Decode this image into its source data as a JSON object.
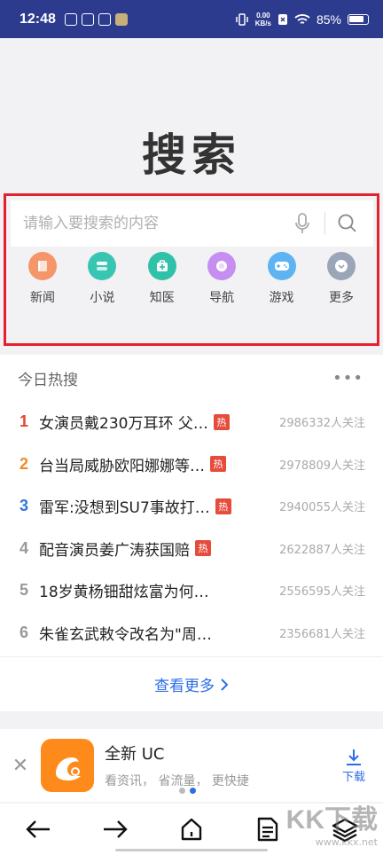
{
  "status_bar": {
    "time": "12:48",
    "net_speed_value": "0.00",
    "net_speed_unit": "KB/s",
    "battery": "85%"
  },
  "page_title": "搜索",
  "search": {
    "placeholder": "请输入要搜索的内容"
  },
  "quick_links": [
    {
      "label": "新闻",
      "color": "#f5956a",
      "icon": "news-icon"
    },
    {
      "label": "小说",
      "color": "#38c6b3",
      "icon": "novel-icon"
    },
    {
      "label": "知医",
      "color": "#2fc2a8",
      "icon": "medical-kit-icon"
    },
    {
      "label": "导航",
      "color": "#c58ef0",
      "icon": "navigation-icon"
    },
    {
      "label": "游戏",
      "color": "#5eb3f2",
      "icon": "gamepad-icon"
    },
    {
      "label": "更多",
      "color": "#9aa5b8",
      "icon": "more-chevron-icon"
    }
  ],
  "hot": {
    "title": "今日热搜",
    "items": [
      {
        "rank": "1",
        "rank_color": "#e6452f",
        "text": "女演员戴230万耳环 父…",
        "badge": "热",
        "follow": "2986332人关注"
      },
      {
        "rank": "2",
        "rank_color": "#f08a2a",
        "text": "台当局威胁欧阳娜娜等…",
        "badge": "热",
        "follow": "2978809人关注"
      },
      {
        "rank": "3",
        "rank_color": "#2d78d8",
        "text": "雷军:没想到SU7事故打…",
        "badge": "热",
        "follow": "2940055人关注"
      },
      {
        "rank": "4",
        "rank_color": "#999999",
        "text": "配音演员姜广涛获国赔",
        "badge": "热",
        "follow": "2622887人关注"
      },
      {
        "rank": "5",
        "rank_color": "#999999",
        "text": "18岁黄杨钿甜炫富为何…",
        "badge": "",
        "follow": "2556595人关注"
      },
      {
        "rank": "6",
        "rank_color": "#999999",
        "text": "朱雀玄武敕令改名为\"周…",
        "badge": "",
        "follow": "2356681人关注"
      }
    ],
    "see_more": "查看更多"
  },
  "ad": {
    "name": "全新 UC",
    "desc": "看资讯， 省流量， 更快捷",
    "download": "下载"
  },
  "watermark": {
    "brand": "KK下载",
    "url": "www.kkx.net"
  },
  "colors": {
    "status_bar": "#2d3b8e",
    "highlight": "#e4222f",
    "link": "#2b6de5"
  }
}
